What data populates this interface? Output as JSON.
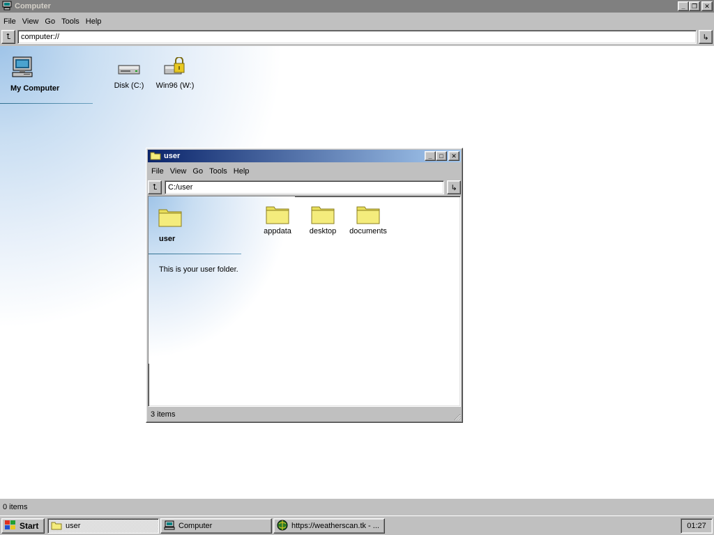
{
  "main_window": {
    "title": "Computer",
    "menu": [
      "File",
      "View",
      "Go",
      "Tools",
      "Help"
    ],
    "address": "computer://",
    "sidebar_title": "My Computer",
    "items": [
      {
        "label": "Disk (C:)",
        "icon": "hard-drive-icon"
      },
      {
        "label": "Win96 (W:)",
        "icon": "locked-drive-icon"
      }
    ],
    "status": "0 items"
  },
  "child_window": {
    "title": "user",
    "menu": [
      "File",
      "View",
      "Go",
      "Tools",
      "Help"
    ],
    "address": "C:/user",
    "sidebar_title": "user",
    "sidebar_description": "This is your user folder.",
    "items": [
      {
        "label": "appdata",
        "icon": "folder-icon"
      },
      {
        "label": "desktop",
        "icon": "folder-icon"
      },
      {
        "label": "documents",
        "icon": "folder-icon"
      }
    ],
    "status": "3 items"
  },
  "taskbar": {
    "start_label": "Start",
    "tasks": [
      {
        "label": "user",
        "icon": "folder-icon",
        "active": true
      },
      {
        "label": "Computer",
        "icon": "computer-icon",
        "active": false
      },
      {
        "label": "https://weatherscan.tk - ...",
        "icon": "browser-icon",
        "active": false
      }
    ],
    "clock": "01:27"
  },
  "colors": {
    "active_title_start": "#0a246a",
    "active_title_end": "#a6caf0",
    "inactive_title": "#808080",
    "folder_yellow": "#f4ec7c"
  }
}
